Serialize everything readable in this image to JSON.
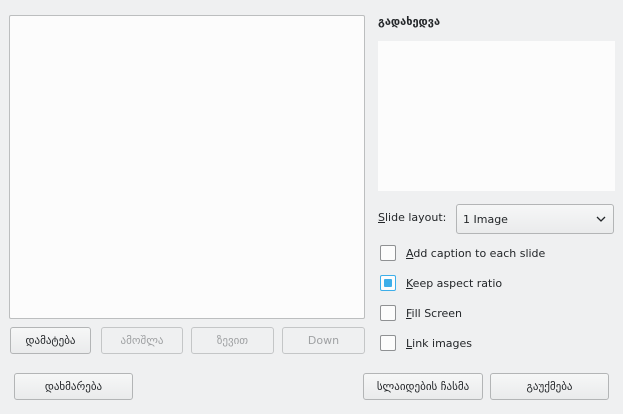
{
  "image_list": {
    "items": []
  },
  "list_buttons": {
    "add": {
      "label": "დამატება",
      "disabled": false
    },
    "remove": {
      "label": "ამოშლა",
      "disabled": true
    },
    "up": {
      "label": "ზევით",
      "disabled": true
    },
    "down": {
      "label": "Down",
      "disabled": true
    }
  },
  "preview": {
    "title": "გადახედვა"
  },
  "slide_layout": {
    "label_prefix": "S",
    "label_rest": "lide layout:",
    "selected": "1 Image"
  },
  "options": [
    {
      "mnemonic": "A",
      "rest": "dd caption to each slide",
      "checked": false
    },
    {
      "mnemonic": "K",
      "rest": "eep aspect ratio",
      "checked": true
    },
    {
      "mnemonic": "F",
      "rest": "ill Screen",
      "checked": false
    },
    {
      "mnemonic": "L",
      "rest": "ink images",
      "checked": false
    }
  ],
  "footer": {
    "help": "დახმარება",
    "insert": "სლაიდების ჩასმა",
    "cancel": "გაუქმება"
  },
  "colors": {
    "accent": "#3daee9",
    "window_bg": "#eff0f1"
  }
}
